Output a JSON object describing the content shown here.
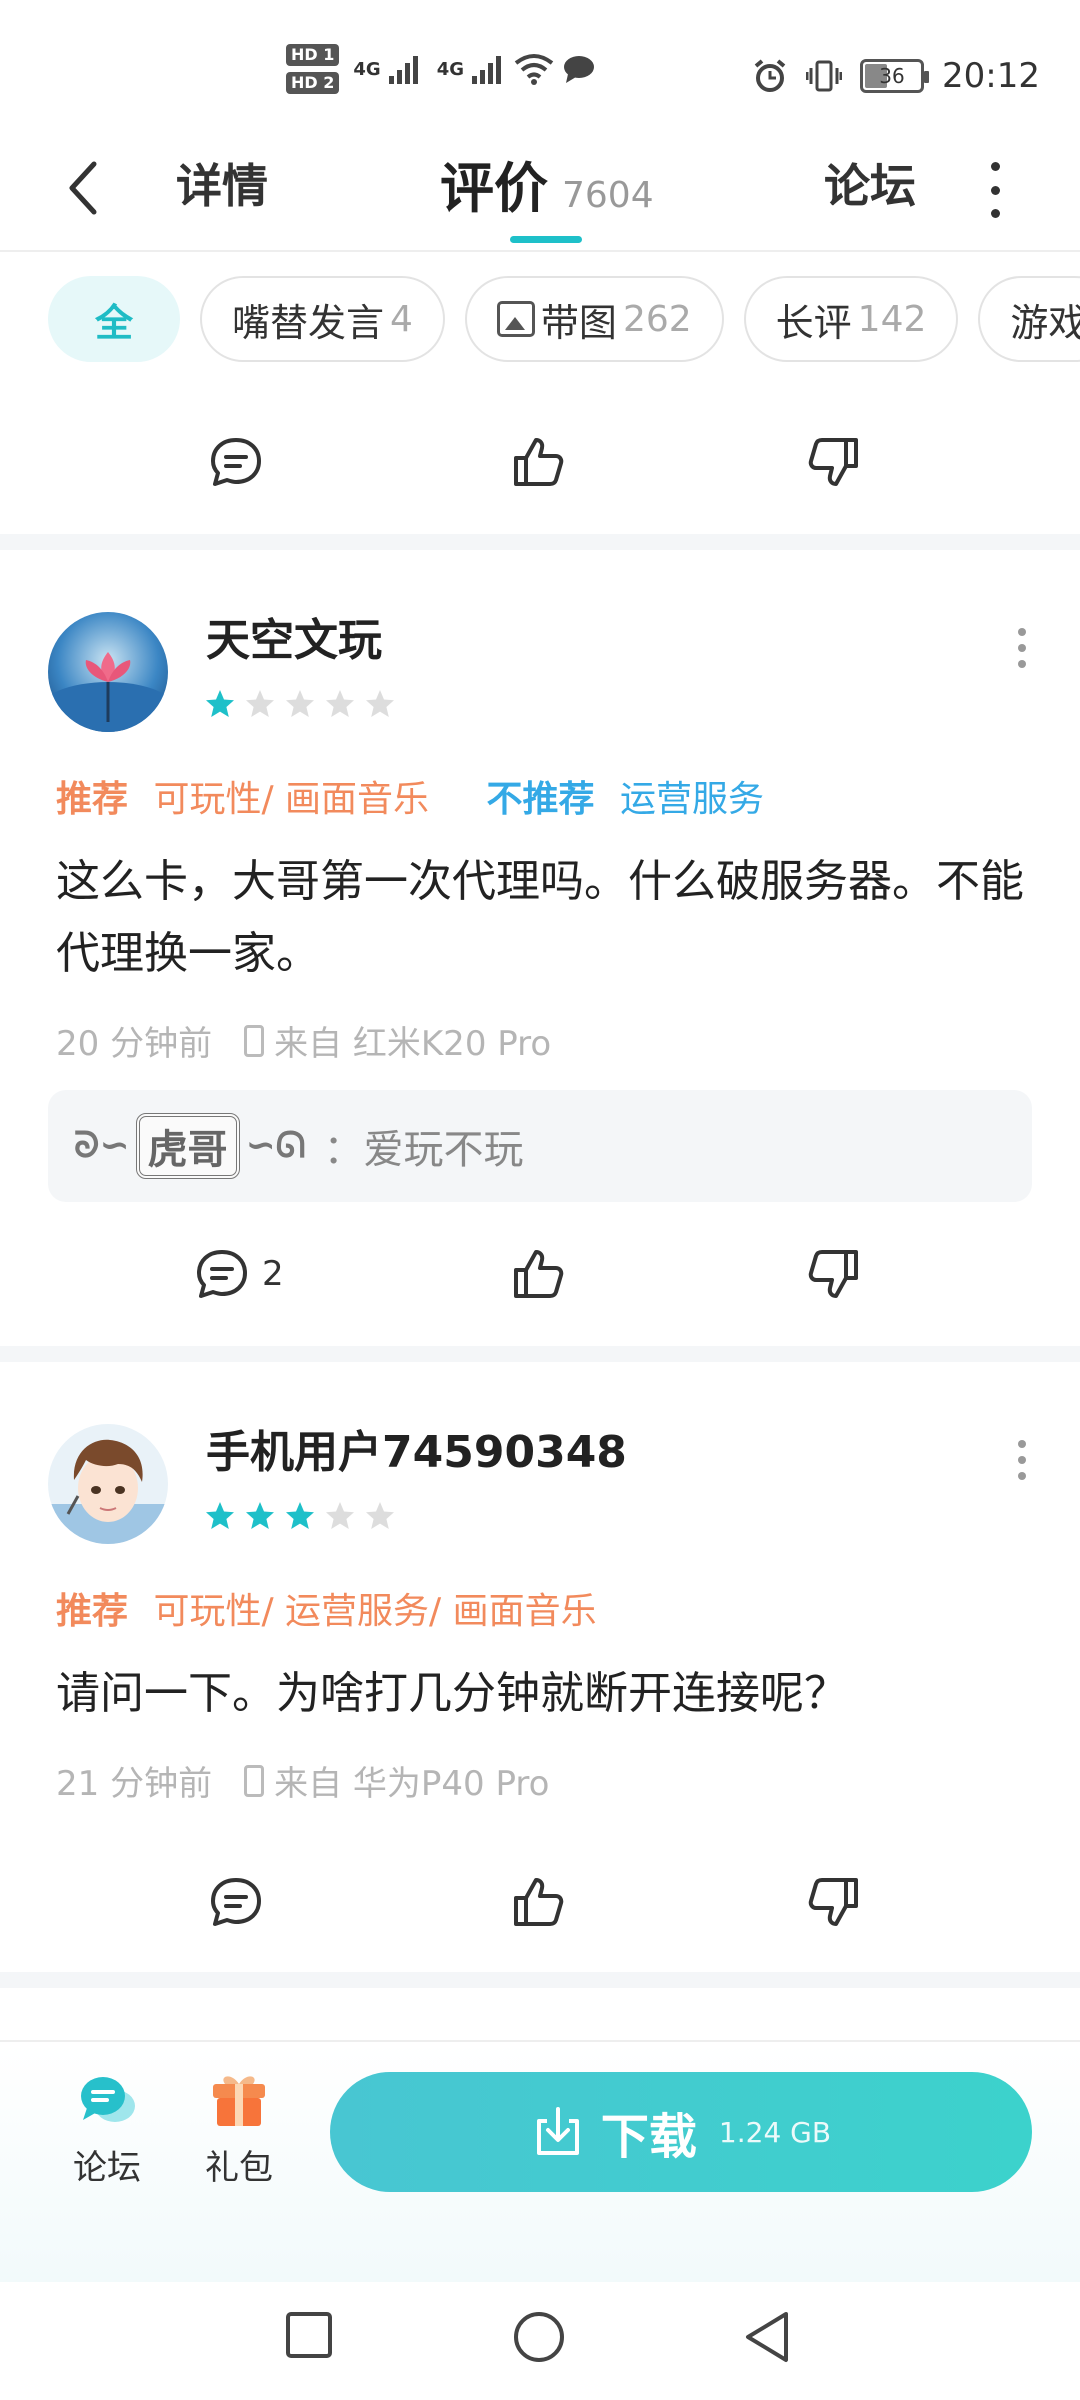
{
  "status_bar": {
    "hd1": "HD 1",
    "hd2": "HD 2",
    "net1": "4G",
    "net2": "4G",
    "battery": "36",
    "time": "20:12"
  },
  "nav": {
    "detail": "详情",
    "review": "评价",
    "review_count": "7604",
    "forum": "论坛"
  },
  "filters": [
    {
      "label": "全",
      "count": ""
    },
    {
      "label": "嘴替发言",
      "count": "4"
    },
    {
      "label": "带图",
      "count": "262"
    },
    {
      "label": "长评",
      "count": "142"
    },
    {
      "label": "游戏",
      "count": ""
    }
  ],
  "reviews": [
    {
      "username": "天空文玩",
      "rating": 1,
      "recommend_label": "推荐",
      "recommend_items": "可玩性/ 画面音乐",
      "not_recommend_label": "不推荐",
      "not_recommend_items": "运营服务",
      "text": "这么卡，大哥第一次代理吗。什么破服务器。不能代理换一家。",
      "time": "20 分钟前",
      "device": "来自 红米K20 Pro",
      "reply_badge": "虎哥",
      "reply_text": "：爱玩不玩",
      "comment_count": "2"
    },
    {
      "username": "手机用户74590348",
      "rating": 3,
      "recommend_label": "推荐",
      "recommend_items": "可玩性/ 运营服务/ 画面音乐",
      "text": "请问一下。为啥打几分钟就断开连接呢？",
      "time": "21 分钟前",
      "device": "来自 华为P40 Pro"
    }
  ],
  "bottom_bar": {
    "forum": "论坛",
    "gift": "礼包",
    "download": "下载",
    "size": "1.24 GB"
  },
  "colors": {
    "accent": "#1ec0c9",
    "recommend": "#f28a5c",
    "not_recommend": "#34a9e6",
    "star_on": "#1ec0c9",
    "star_off": "#dddddd"
  }
}
